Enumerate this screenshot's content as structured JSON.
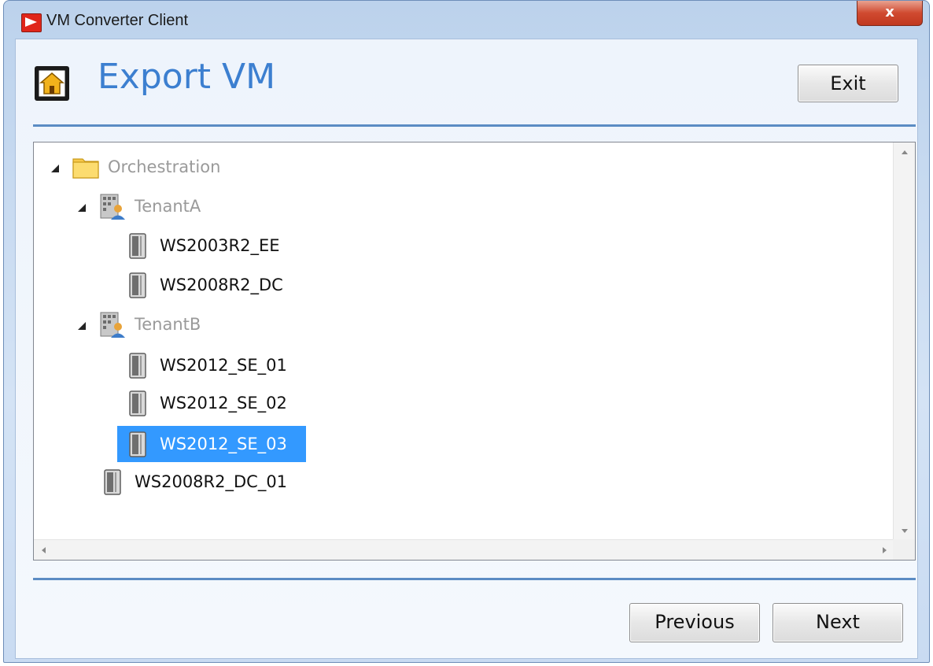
{
  "window": {
    "title": "VM Converter Client",
    "close_label": "x"
  },
  "header": {
    "title": "Export VM",
    "exit_label": "Exit"
  },
  "tree": {
    "root": {
      "label": "Orchestration",
      "icon": "folder-icon"
    },
    "tenant_a": {
      "label": "TenantA",
      "icon": "tenant-icon"
    },
    "tenant_a_vms": [
      "WS2003R2_EE",
      "WS2008R2_DC"
    ],
    "tenant_b": {
      "label": "TenantB",
      "icon": "tenant-icon"
    },
    "tenant_b_vms": [
      "WS2012_SE_01",
      "WS2012_SE_02",
      "WS2012_SE_03"
    ],
    "selected": "WS2012_SE_03",
    "root_vms": [
      "WS2008R2_DC_01"
    ]
  },
  "footer": {
    "previous_label": "Previous",
    "next_label": "Next"
  },
  "colors": {
    "accent": "#3c7fd0",
    "selection": "#3399ff",
    "rule": "#5b8cc4",
    "close": "#c0381f"
  }
}
